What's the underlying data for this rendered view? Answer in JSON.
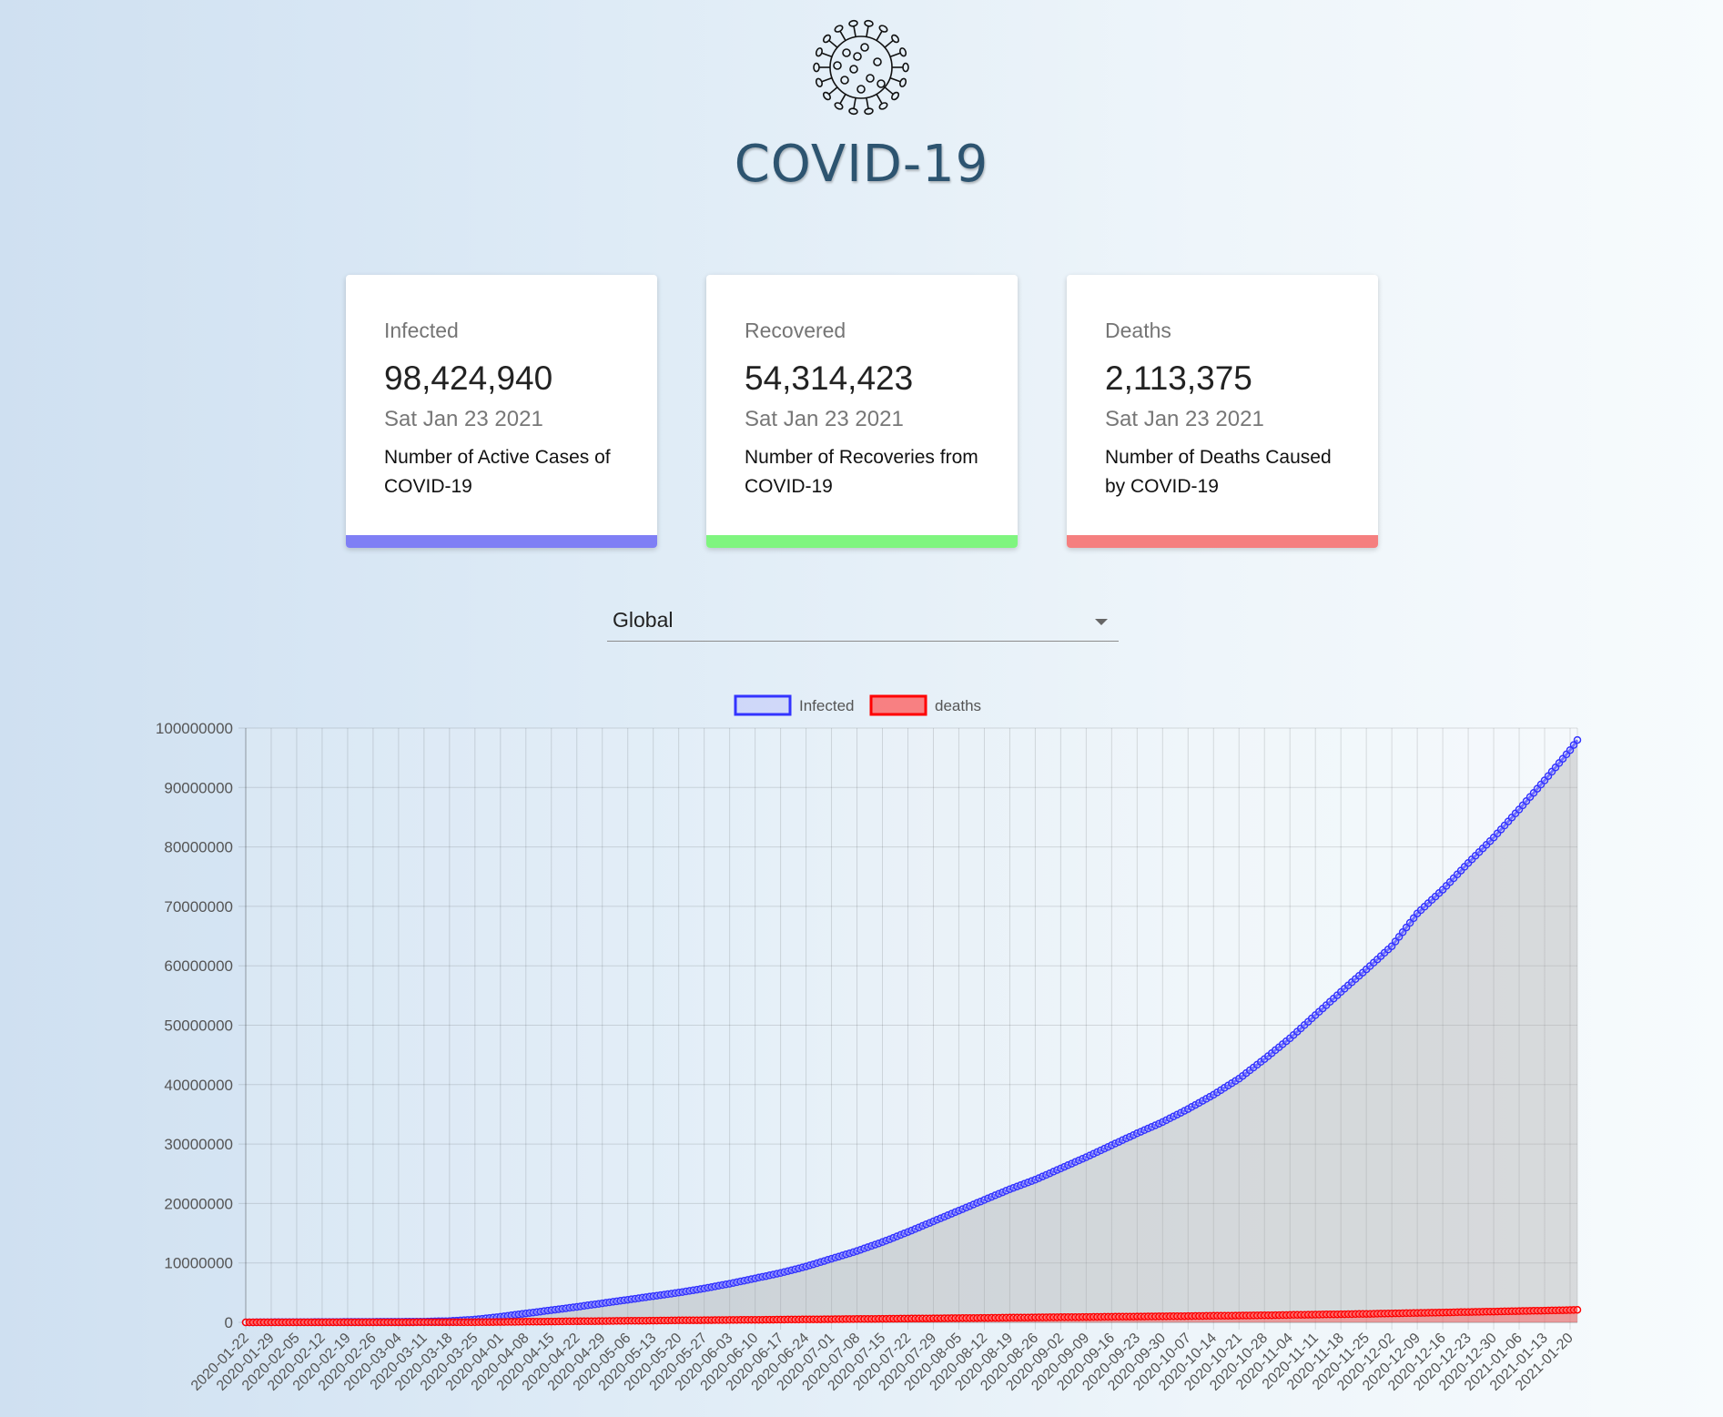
{
  "header": {
    "title": "COVID-19",
    "logo_icon": "virus-icon"
  },
  "cards": [
    {
      "id": "infected",
      "label": "Infected",
      "value": "98,424,940",
      "date": "Sat Jan 23 2021",
      "description": "Number of Active Cases of COVID-19",
      "color": "#7f7ff5"
    },
    {
      "id": "recovered",
      "label": "Recovered",
      "value": "54,314,423",
      "date": "Sat Jan 23 2021",
      "description": "Number of Recoveries from COVID-19",
      "color": "#7ff57f"
    },
    {
      "id": "deaths",
      "label": "Deaths",
      "value": "2,113,375",
      "date": "Sat Jan 23 2021",
      "description": "Number of Deaths Caused by COVID-19",
      "color": "#f57f7f"
    }
  ],
  "country_select": {
    "value": "Global",
    "icon": "chevron-down-icon"
  },
  "chart_data": {
    "type": "line",
    "legend": [
      "Infected",
      "deaths"
    ],
    "legend_position": "top",
    "grid": true,
    "ylim": [
      0,
      100000000
    ],
    "yticks": [
      0,
      10000000,
      20000000,
      30000000,
      40000000,
      50000000,
      60000000,
      70000000,
      80000000,
      90000000,
      100000000
    ],
    "x_start": "2020-01-22",
    "x_end": "2021-01-22",
    "xticks": [
      "2020-01-22",
      "2020-01-29",
      "2020-02-05",
      "2020-02-12",
      "2020-02-19",
      "2020-02-26",
      "2020-03-04",
      "2020-03-11",
      "2020-03-18",
      "2020-03-25",
      "2020-04-01",
      "2020-04-08",
      "2020-04-15",
      "2020-04-22",
      "2020-04-29",
      "2020-05-06",
      "2020-05-13",
      "2020-05-20",
      "2020-05-27",
      "2020-06-03",
      "2020-06-10",
      "2020-06-17",
      "2020-06-24",
      "2020-07-01",
      "2020-07-08",
      "2020-07-15",
      "2020-07-22",
      "2020-07-29",
      "2020-08-05",
      "2020-08-12",
      "2020-08-19",
      "2020-08-26",
      "2020-09-02",
      "2020-09-09",
      "2020-09-16",
      "2020-09-23",
      "2020-09-30",
      "2020-10-07",
      "2020-10-14",
      "2020-10-21",
      "2020-10-28",
      "2020-11-04",
      "2020-11-11",
      "2020-11-18",
      "2020-11-25",
      "2020-12-02",
      "2020-12-09",
      "2020-12-16",
      "2020-12-23",
      "2020-12-30",
      "2021-01-06",
      "2021-01-13",
      "2021-01-20"
    ],
    "series": [
      {
        "name": "Infected",
        "color": "#3333ff",
        "fill": "rgba(160,160,160,0.35)",
        "points": [
          [
            "2020-01-22",
            600
          ],
          [
            "2020-02-12",
            60000
          ],
          [
            "2020-03-04",
            95000
          ],
          [
            "2020-03-11",
            125000
          ],
          [
            "2020-03-18",
            220000
          ],
          [
            "2020-03-25",
            470000
          ],
          [
            "2020-04-01",
            930000
          ],
          [
            "2020-04-08",
            1500000
          ],
          [
            "2020-04-15",
            2050000
          ],
          [
            "2020-04-22",
            2600000
          ],
          [
            "2020-04-29",
            3200000
          ],
          [
            "2020-05-06",
            3800000
          ],
          [
            "2020-05-13",
            4400000
          ],
          [
            "2020-05-20",
            5000000
          ],
          [
            "2020-05-27",
            5700000
          ],
          [
            "2020-06-03",
            6500000
          ],
          [
            "2020-06-10",
            7400000
          ],
          [
            "2020-06-17",
            8300000
          ],
          [
            "2020-06-24",
            9400000
          ],
          [
            "2020-07-01",
            10700000
          ],
          [
            "2020-07-08",
            12000000
          ],
          [
            "2020-07-15",
            13500000
          ],
          [
            "2020-07-22",
            15200000
          ],
          [
            "2020-07-29",
            17000000
          ],
          [
            "2020-08-05",
            18800000
          ],
          [
            "2020-08-12",
            20600000
          ],
          [
            "2020-08-19",
            22400000
          ],
          [
            "2020-08-26",
            24000000
          ],
          [
            "2020-09-02",
            25900000
          ],
          [
            "2020-09-09",
            27800000
          ],
          [
            "2020-09-16",
            29800000
          ],
          [
            "2020-09-23",
            31800000
          ],
          [
            "2020-09-30",
            33700000
          ],
          [
            "2020-10-07",
            35900000
          ],
          [
            "2020-10-14",
            38300000
          ],
          [
            "2020-10-21",
            41000000
          ],
          [
            "2020-10-28",
            44300000
          ],
          [
            "2020-11-04",
            47800000
          ],
          [
            "2020-11-11",
            51700000
          ],
          [
            "2020-11-18",
            55600000
          ],
          [
            "2020-11-25",
            59400000
          ],
          [
            "2020-12-02",
            63300000
          ],
          [
            "2020-12-09",
            68800000
          ],
          [
            "2020-12-16",
            72800000
          ],
          [
            "2020-12-23",
            77300000
          ],
          [
            "2020-12-30",
            81600000
          ],
          [
            "2021-01-06",
            86300000
          ],
          [
            "2021-01-13",
            91200000
          ],
          [
            "2021-01-20",
            96300000
          ],
          [
            "2021-01-22",
            98000000
          ]
        ]
      },
      {
        "name": "deaths",
        "color": "#ff0000",
        "fill": "rgba(255,80,80,0.45)",
        "points": [
          [
            "2020-01-22",
            17
          ],
          [
            "2020-03-04",
            3300
          ],
          [
            "2020-03-25",
            22000
          ],
          [
            "2020-04-15",
            140000
          ],
          [
            "2020-05-20",
            330000
          ],
          [
            "2020-06-24",
            490000
          ],
          [
            "2020-07-29",
            670000
          ],
          [
            "2020-08-26",
            830000
          ],
          [
            "2020-09-30",
            1010000
          ],
          [
            "2020-10-28",
            1180000
          ],
          [
            "2020-11-25",
            1420000
          ],
          [
            "2020-12-23",
            1730000
          ],
          [
            "2021-01-20",
            2060000
          ],
          [
            "2021-01-22",
            2110000
          ]
        ]
      }
    ]
  }
}
